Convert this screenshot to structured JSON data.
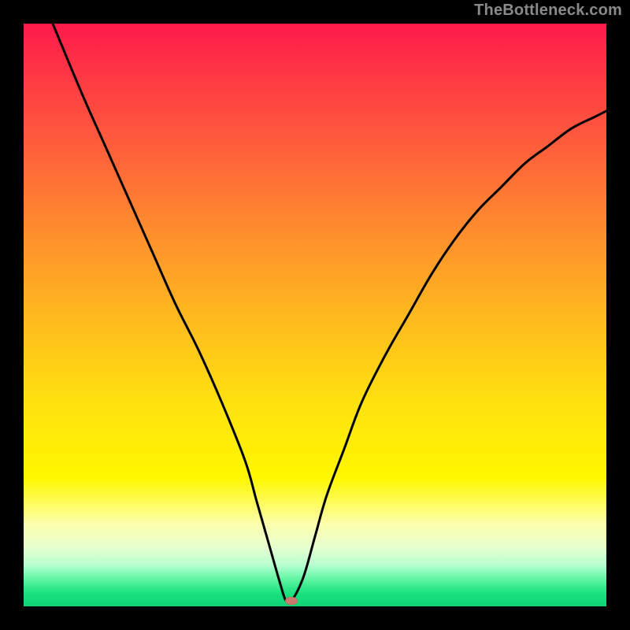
{
  "watermark": "TheBottleneck.com",
  "chart_data": {
    "type": "line",
    "title": "",
    "xlabel": "",
    "ylabel": "",
    "xlim": [
      0,
      100
    ],
    "ylim": [
      0,
      100
    ],
    "x": [
      5,
      10,
      14,
      18,
      22,
      26,
      30,
      34,
      38,
      40,
      42,
      44,
      45,
      46,
      48,
      50,
      52,
      55,
      58,
      62,
      66,
      70,
      74,
      78,
      82,
      86,
      90,
      94,
      98,
      100
    ],
    "values": [
      100,
      88,
      79,
      70,
      61,
      52,
      44,
      35,
      25,
      18,
      11,
      4,
      1,
      1,
      5,
      12,
      19,
      27,
      35,
      43,
      50,
      57,
      63,
      68,
      72,
      76,
      79,
      82,
      84,
      85
    ],
    "minimum_x": 45,
    "marker": {
      "x": 46,
      "y": 1,
      "color": "#c97a6e"
    },
    "gradient_stops": [
      {
        "pos": 0,
        "color": "#ff1a4b"
      },
      {
        "pos": 50,
        "color": "#ffe10f"
      },
      {
        "pos": 93,
        "color": "#b5ffcf"
      },
      {
        "pos": 100,
        "color": "#10d477"
      }
    ]
  }
}
